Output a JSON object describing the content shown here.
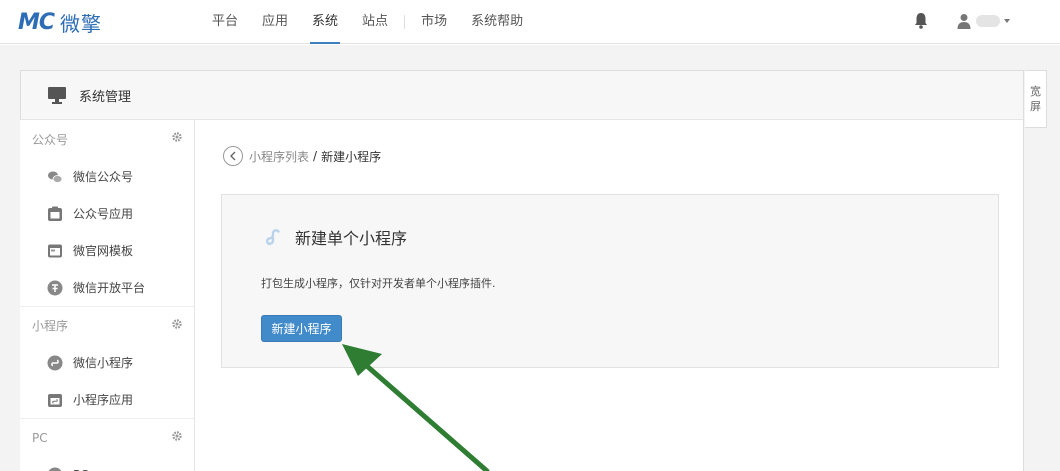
{
  "brand": {
    "mark": "MC",
    "name": "微擎",
    "color": "#2d6db5"
  },
  "nav": {
    "items": [
      "平台",
      "应用",
      "系统",
      "站点",
      "市场",
      "系统帮助"
    ],
    "active": "系统"
  },
  "header_icons": {
    "bell": "bell-icon",
    "user": "user-icon"
  },
  "panel": {
    "title": "系统管理"
  },
  "wide_toggle": "宽屏",
  "sidebar": {
    "groups": [
      {
        "title": "公众号",
        "items": [
          {
            "label": "微信公众号",
            "icon": "wechat-icon"
          },
          {
            "label": "公众号应用",
            "icon": "app-icon"
          },
          {
            "label": "微官网模板",
            "icon": "template-icon"
          },
          {
            "label": "微信开放平台",
            "icon": "open-platform-icon"
          }
        ]
      },
      {
        "title": "小程序",
        "items": [
          {
            "label": "微信小程序",
            "icon": "miniprogram-icon"
          },
          {
            "label": "小程序应用",
            "icon": "miniprogram-app-icon"
          }
        ]
      },
      {
        "title": "PC",
        "items": [
          {
            "label": "PC",
            "icon": "pc-icon"
          }
        ]
      }
    ]
  },
  "breadcrumb": {
    "link": "小程序列表",
    "separator": "/",
    "current": "新建小程序"
  },
  "card": {
    "title": "新建单个小程序",
    "description": "打包生成小程序，仅针对开发者单个小程序插件.",
    "button": "新建小程序"
  },
  "colors": {
    "accent": "#428bca",
    "annotation_arrow": "#2e7d32"
  }
}
